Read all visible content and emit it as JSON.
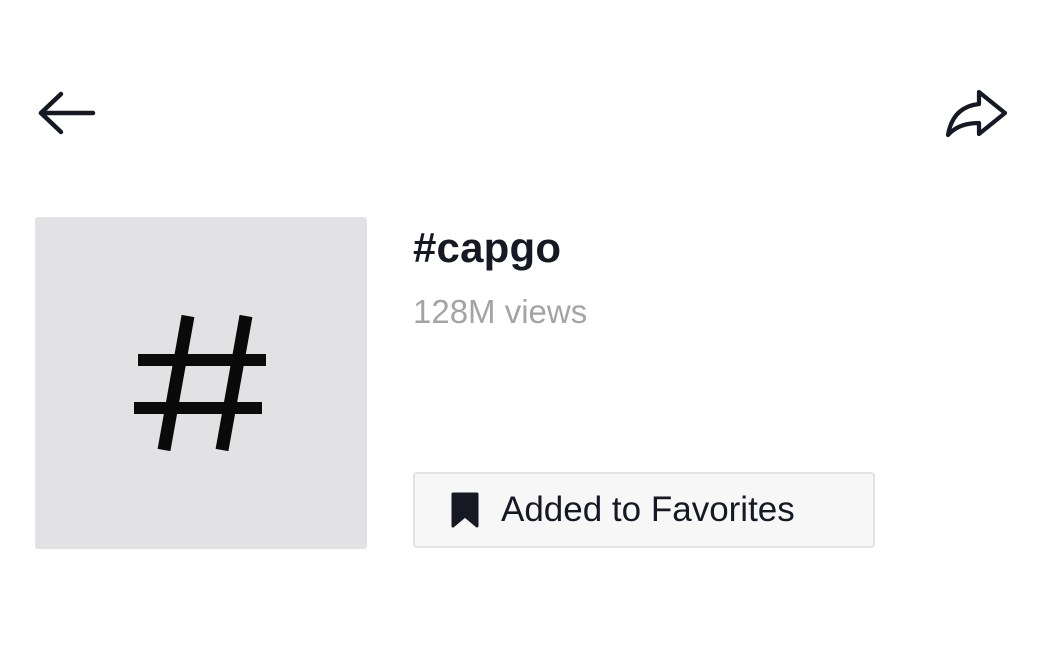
{
  "header": {
    "back_icon": "arrow-left-icon",
    "share_icon": "share-arrow-icon"
  },
  "hashtag": {
    "cover_icon": "hashtag-icon",
    "cover_background": "#e2e2e4",
    "title": "#capgo",
    "views": "128M views"
  },
  "favorites_button": {
    "icon": "bookmark-filled-icon",
    "label": "Added to Favorites"
  },
  "colors": {
    "primary_text": "#161823",
    "secondary_text": "#a4a4a8",
    "button_border": "#e3e3e5",
    "button_background": "#f7f7f8"
  }
}
